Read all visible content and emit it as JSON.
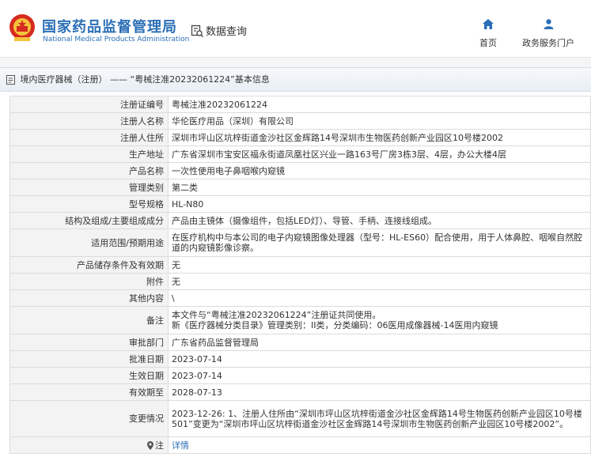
{
  "header": {
    "brand_cn": "国家药品监督管理局",
    "brand_en": "National Medical Products Administration",
    "data_query": "数据查询",
    "nav_home": "首页",
    "nav_portal": "政务服务门户"
  },
  "breadcrumb": {
    "category": "境内医疗器械（注册）",
    "separator": "——",
    "title": "“粤械注准20232061224”基本信息"
  },
  "details": {
    "rows": [
      {
        "label": "注册证编号",
        "value": "粤械注准20232061224"
      },
      {
        "label": "注册人名称",
        "value": "华伦医疗用品（深圳）有限公司"
      },
      {
        "label": "注册人住所",
        "value": "深圳市坪山区坑梓街道金沙社区金辉路14号深圳市生物医药创新产业园区10号楼2002"
      },
      {
        "label": "生产地址",
        "value": "广东省深圳市宝安区福永街道凤凰社区兴业一路163号厂房3栋3层、4层，办公大楼4层"
      },
      {
        "label": "产品名称",
        "value": "一次性使用电子鼻咽喉内窥镜"
      },
      {
        "label": "管理类别",
        "value": "第二类"
      },
      {
        "label": "型号规格",
        "value": "HL-N80"
      },
      {
        "label": "结构及组成/主要组成成分",
        "value": "产品由主镜体（摄像组件，包括LED灯）、导管、手柄、连接线组成。"
      },
      {
        "label": "适用范围/预期用途",
        "value": "在医疗机构中与本公司的电子内窥镜图像处理器（型号：HL-ES60）配合使用，用于人体鼻腔、咽喉自然腔道的内窥镜影像诊察。"
      },
      {
        "label": "产品储存条件及有效期",
        "value": "无"
      },
      {
        "label": "附件",
        "value": "无"
      },
      {
        "label": "其他内容",
        "value": "\\"
      },
      {
        "label": "备注",
        "value": "本文件与“粤械注准20232061224”注册证共同使用。",
        "value2": "新《医疗器械分类目录》管理类别：II类，分类编码：06医用成像器械-14医用内窥镜"
      },
      {
        "label": "审批部门",
        "value": "广东省药品监督管理局"
      },
      {
        "label": "批准日期",
        "value": "2023-07-14"
      },
      {
        "label": "生效日期",
        "value": "2023-07-14"
      },
      {
        "label": "有效期至",
        "value": "2028-07-13"
      },
      {
        "label": "变更情况",
        "value": "2023-12-26: 1、注册人住所由“深圳市坪山区坑梓街道金沙社区金辉路14号生物医药创新产业园区10号楼501”变更为“深圳市坪山区坑梓街道金沙社区金辉路14号深圳市生物医药创新产业园区10号楼2002”。"
      }
    ],
    "note_label": "注",
    "note_link": "详情"
  },
  "colors": {
    "brand_blue": "#2b6fb6",
    "label_bg": "#f3f3f3",
    "border": "#dcdcdc"
  }
}
